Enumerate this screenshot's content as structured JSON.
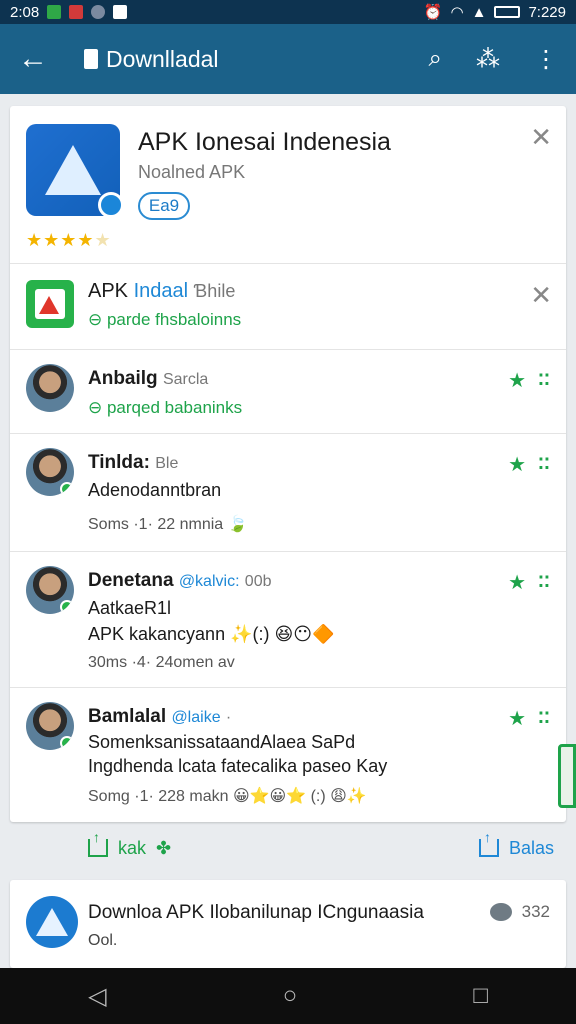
{
  "status_bar": {
    "time_left": "2:08",
    "time_right": "7:229"
  },
  "app_bar": {
    "back_icon": "arrow-left-icon",
    "title": "Downlladal",
    "actions": [
      "search-icon",
      "share-network-icon",
      "more-vert-icon"
    ]
  },
  "top_app": {
    "name": "APK Ionesai Indenesia",
    "sub": "Noalned APK",
    "pill_label": "Ea9",
    "stars": "★★★★",
    "star_empty": "★",
    "rating_out_of_5": 4
  },
  "second_app": {
    "name": "APK",
    "name_blue": "Indaal",
    "name_grey": "Ɓhile",
    "status": "parde fhsbaloinns"
  },
  "rows": [
    {
      "name": "Anbailg",
      "grey": "Sarcla",
      "status": "parqed babaninks"
    },
    {
      "name": "Tinlda:",
      "grey": "Ble",
      "line": "Adenodanntbran",
      "meta": "Soms ·1· 22 nmnia"
    },
    {
      "name": "Denetana",
      "handle": "@kalvic:",
      "grey": "00b",
      "line1": "AatkaeR1l",
      "line2": "APK kakancyann ✨(:) 😆😶🔶",
      "meta": "30ms ·4· 24omen av"
    },
    {
      "name": "Bamlalal",
      "handle": "@laike",
      "grey": "·",
      "line1": "SomenksanissataandAlaea SaPd",
      "line2": "Ingdhenda lcata fatecalika paseo Kay",
      "meta": "Somg ·1· 228 makn 😀⭐😀⭐ (:) 😩✨"
    }
  ],
  "actions": {
    "left_label": "kak",
    "right_label": "Balas"
  },
  "news": {
    "title": "Downloa APK Ilobanilunap ICngunaasia",
    "sub": "Ool.",
    "count": "332"
  },
  "colors": {
    "app_bar": "#1b6189",
    "status_bar": "#0d3350",
    "accent_green": "#1ea34a",
    "accent_blue": "#1e88d6"
  }
}
